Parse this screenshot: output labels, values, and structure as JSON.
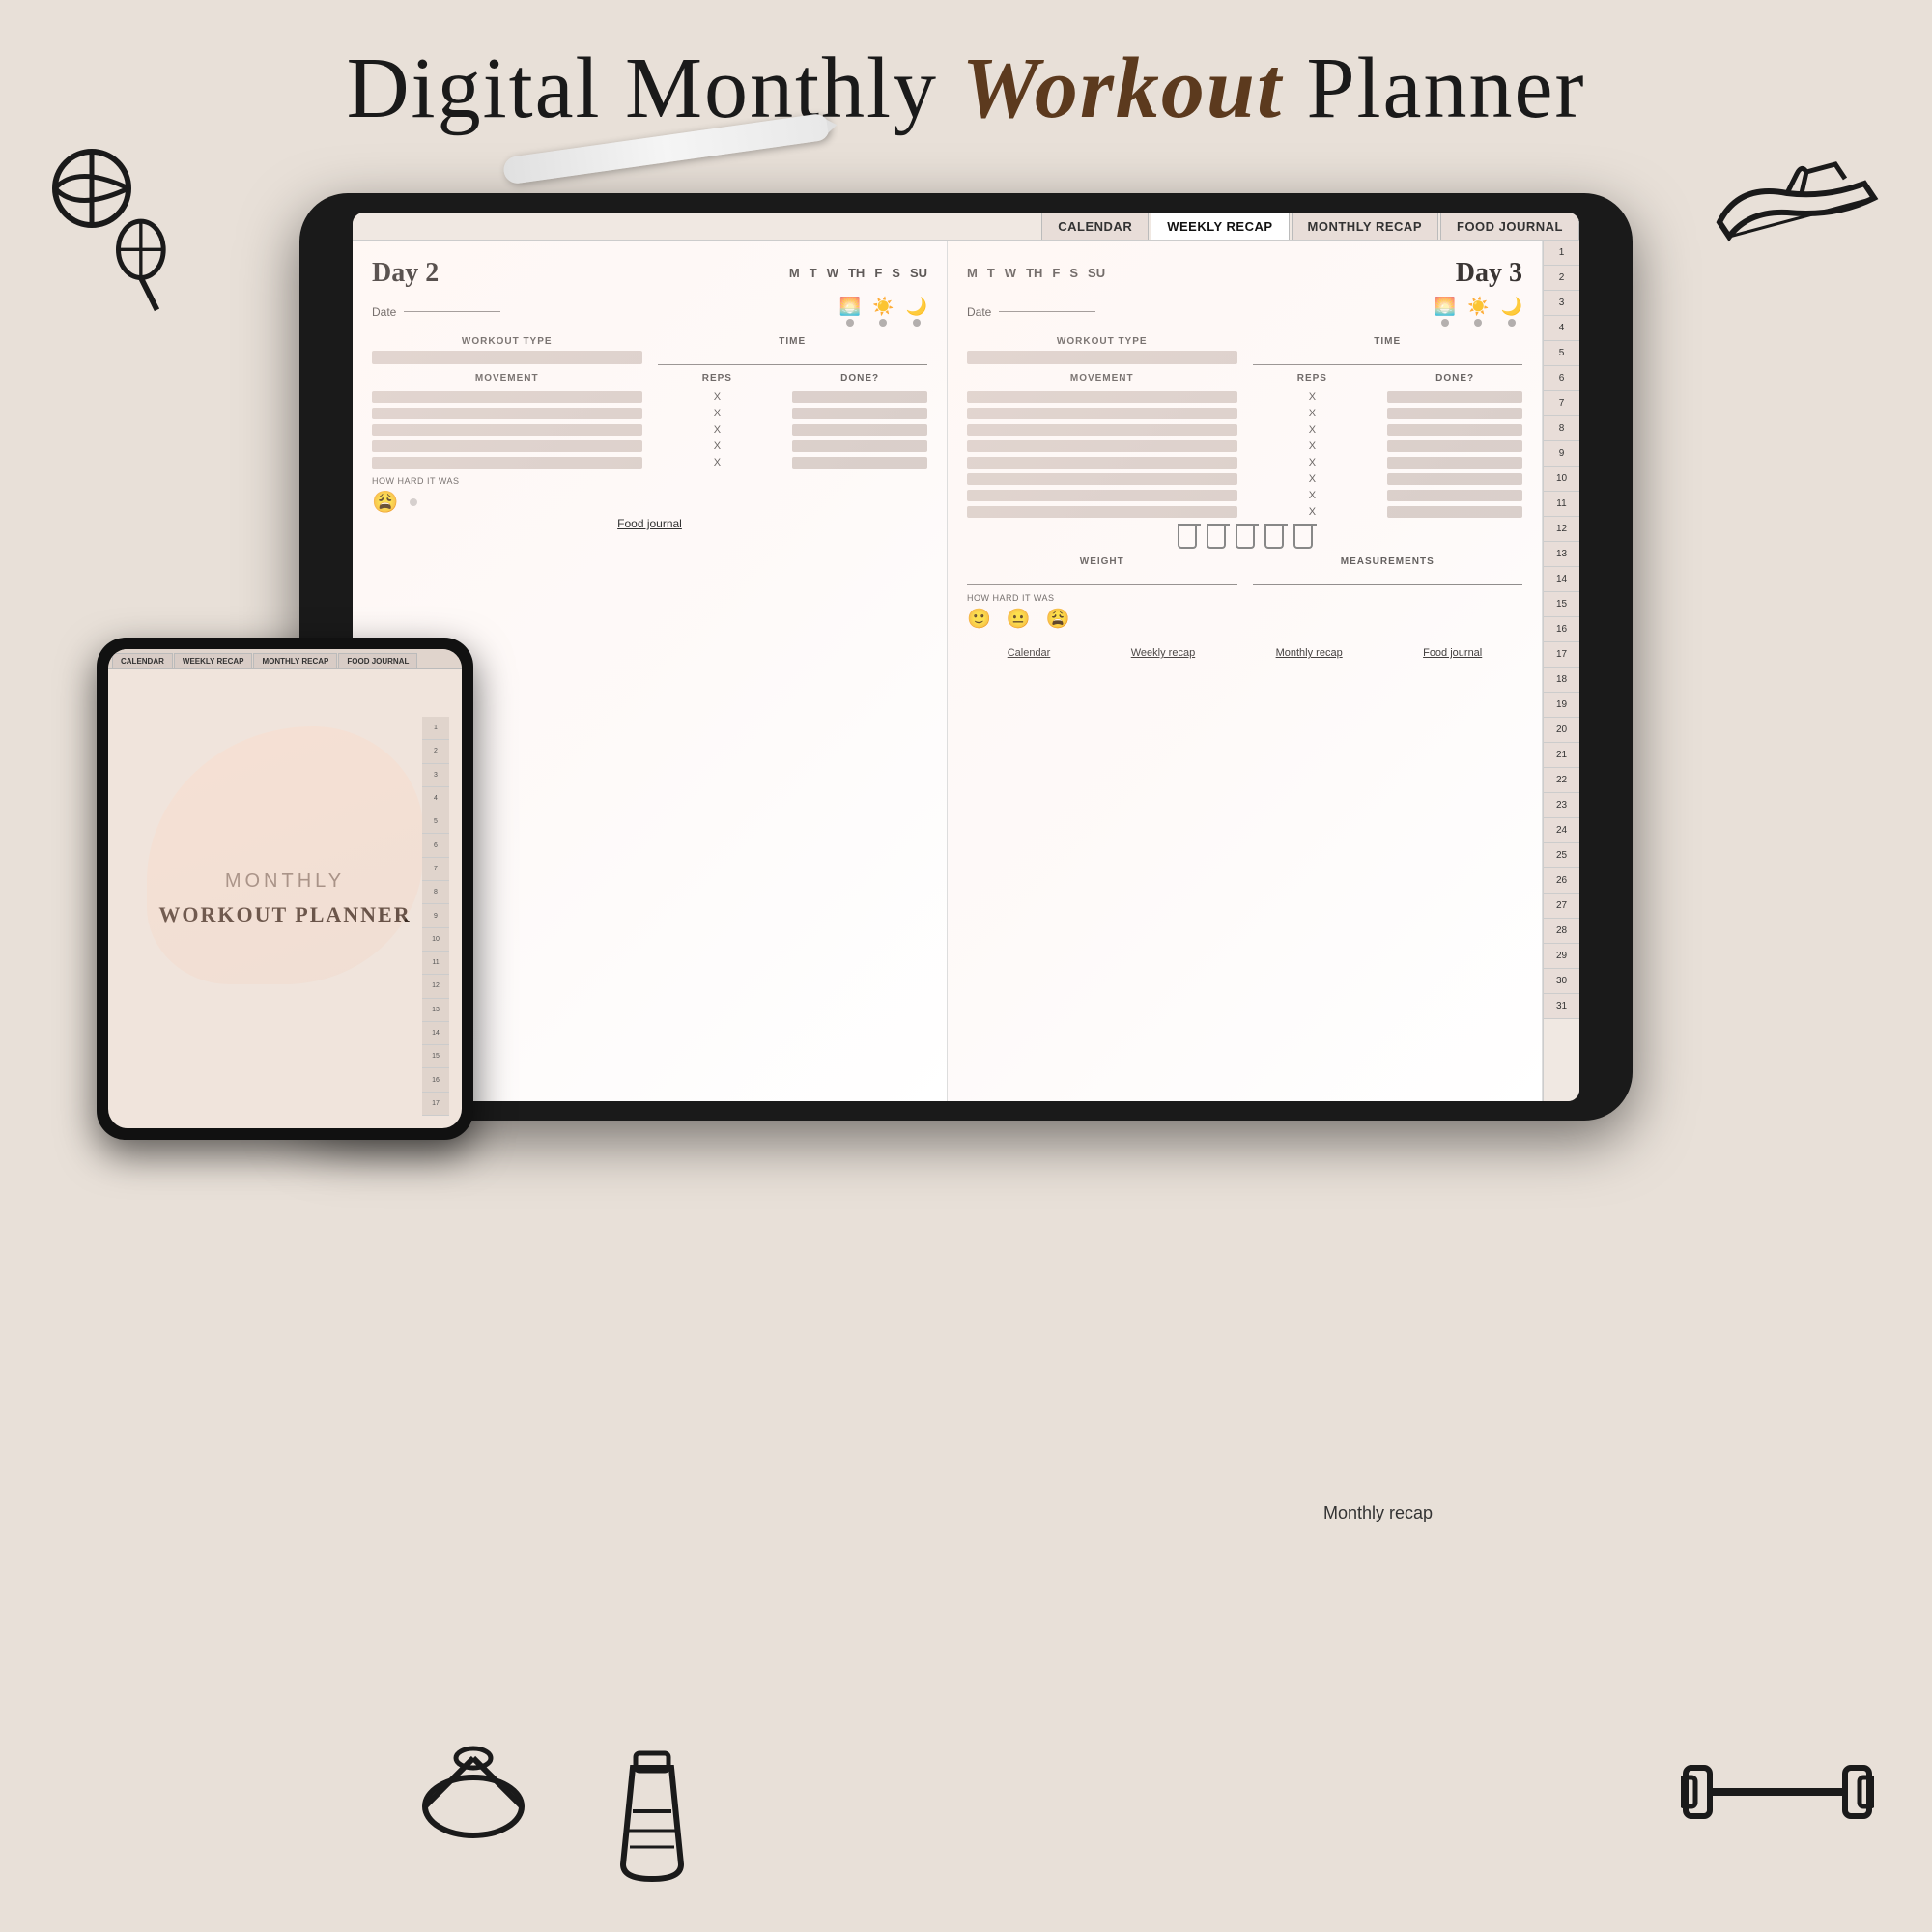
{
  "page": {
    "title_part1": "Digital Monthly ",
    "title_bold": "Workout",
    "title_part2": " Planner",
    "bg_color": "#e8e0d8"
  },
  "tabs": {
    "items": [
      "CALENDAR",
      "WEEKLY RECAP",
      "MONTHLY RECAP",
      "FOOD JOURNAL"
    ]
  },
  "side_numbers": [
    "1",
    "2",
    "3",
    "4",
    "5",
    "6",
    "7",
    "8",
    "9",
    "10",
    "11",
    "12",
    "13",
    "14",
    "15",
    "16",
    "17",
    "18",
    "19",
    "20",
    "21",
    "22",
    "23",
    "24",
    "25",
    "26",
    "27",
    "28",
    "29",
    "30",
    "31"
  ],
  "day2": {
    "title": "Day 2",
    "days_row": "M  T  W  TH  F  S  SU",
    "date_label": "Date",
    "sections": {
      "workout_type": "WORKOUT TYPE",
      "time": "TIME",
      "movement": "MOVEMENT",
      "reps": "REPS",
      "done": "DONE?"
    },
    "rows": 5,
    "hard_label": "HOW HARD IT WAS",
    "food_link": "Food journal"
  },
  "day3": {
    "title": "Day 3",
    "days_row": "M  T  W  TH  F  S  SU",
    "date_label": "Date",
    "sections": {
      "workout_type": "WORKOUT TYPE",
      "time": "TIME",
      "movement": "MOVEMENT",
      "reps": "REPS",
      "done": "DONE?"
    },
    "rows": 8,
    "weight_label": "WEIGHT",
    "meas_label": "MEASUREMENTS",
    "hard_label": "HOW HARD IT WAS",
    "bottom_nav": [
      "Calendar",
      "Weekly recap",
      "Monthly recap",
      "Food journal"
    ]
  },
  "small_tablet": {
    "tabs": [
      "CALENDAR",
      "WEEKLY RECAP",
      "MONTHLY RECAP",
      "FOOD JOURNAL"
    ],
    "line1": "MONTHLY",
    "line2": "WORKOUT PLANNER"
  },
  "monthly_recap": "Monthly recap"
}
